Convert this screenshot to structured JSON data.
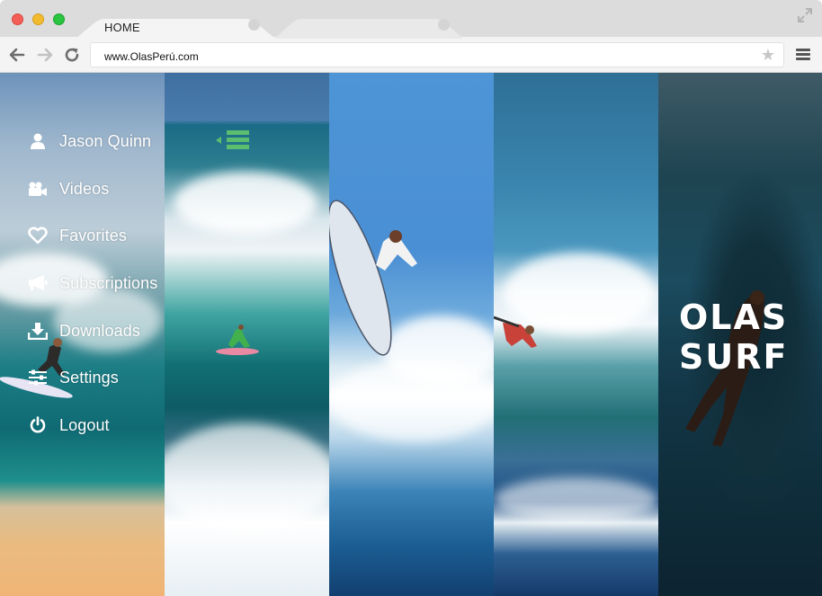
{
  "browser": {
    "tabs": [
      {
        "label": "HOME",
        "active": true
      },
      {
        "label": "",
        "active": false
      }
    ],
    "url": "www.OlasPerú.com",
    "colors": {
      "close": "#f35f57",
      "minimize": "#f2bb2f",
      "maximize": "#29c440"
    }
  },
  "sidebar": {
    "items": [
      {
        "label": "Jason Quinn",
        "icon": "user-icon"
      },
      {
        "label": "Videos",
        "icon": "video-camera-icon"
      },
      {
        "label": "Favorites",
        "icon": "heart-icon"
      },
      {
        "label": "Subscriptions",
        "icon": "megaphone-icon"
      },
      {
        "label": "Downloads",
        "icon": "download-icon"
      },
      {
        "label": "Settings",
        "icon": "sliders-icon"
      },
      {
        "label": "Logout",
        "icon": "power-icon"
      }
    ],
    "toggle_color": "#5bbd6e"
  },
  "brand": {
    "line1": "OLAS",
    "line2": "SURF"
  }
}
